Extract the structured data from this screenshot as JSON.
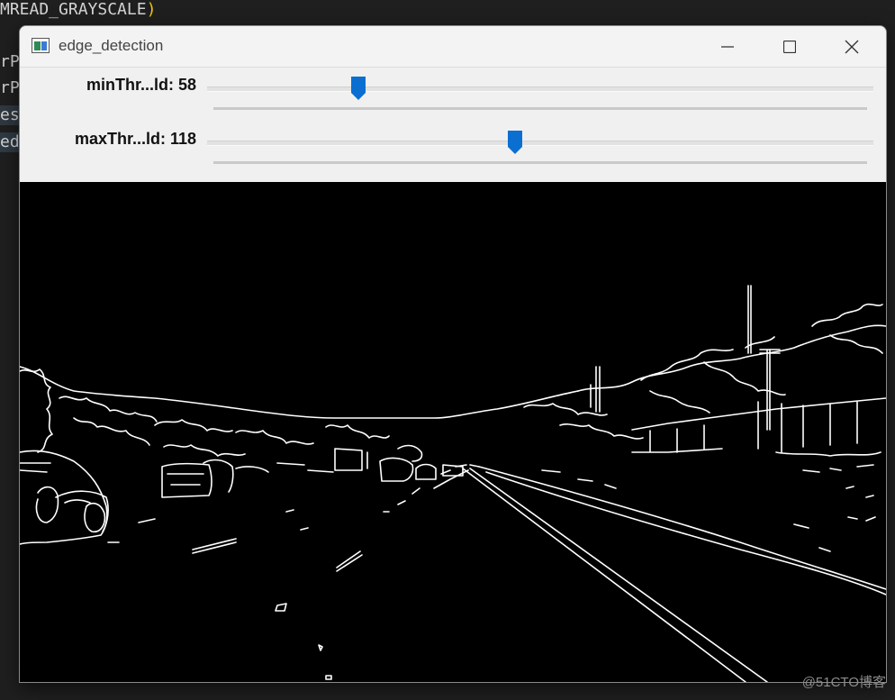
{
  "editor": {
    "line1": "MREAD_GRAYSCALE",
    "line1_paren": ")",
    "line2": "rP",
    "line3": "rP",
    "line4": "es",
    "line5": "ed"
  },
  "window": {
    "title": "edge_detection"
  },
  "trackbars": [
    {
      "label": "minThr...ld: 58",
      "value": 58,
      "max": 255
    },
    {
      "label": "maxThr...ld: 118",
      "value": 118,
      "max": 255
    }
  ],
  "colors": {
    "thumb": "#0a6fd1",
    "canvas_bg": "#000000",
    "edges": "#ffffff"
  },
  "watermark": "@51CTO博客"
}
